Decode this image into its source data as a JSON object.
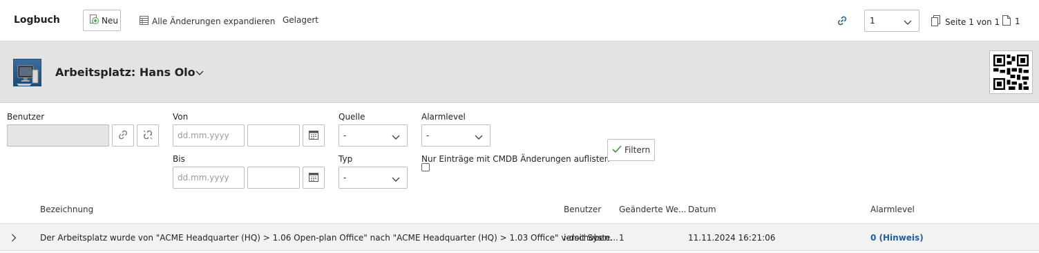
{
  "toolbar": {
    "title": "Logbuch",
    "new_label": "Neu",
    "expand_label": "Alle Änderungen expandieren",
    "archived_label": "Gelagert",
    "page_select_value": "1",
    "page_info": "Seite 1 von 1",
    "page_count": "1"
  },
  "header": {
    "object_title": "Arbeitsplatz: Hans Olo"
  },
  "filter": {
    "benutzer_label": "Benutzer",
    "benutzer_value": "",
    "von_label": "Von",
    "bis_label": "Bis",
    "date_placeholder": "dd.mm.yyyy",
    "quelle_label": "Quelle",
    "quelle_value": "-",
    "typ_label": "Typ",
    "typ_value": "-",
    "alarmlevel_label": "Alarmlevel",
    "alarmlevel_value": "-",
    "cmdb_only_label": "Nur Einträge mit CMDB Änderungen auflisten",
    "filter_button": "Filtern"
  },
  "table": {
    "headers": {
      "bezeichnung": "Bezeichnung",
      "benutzer": "Benutzer",
      "geaenderte": "Geänderte We...",
      "datum": "Datum",
      "alarmlevel": "Alarmlevel"
    },
    "rows": [
      {
        "bezeichnung": "Der Arbeitsplatz wurde von \"ACME Headquarter (HQ) > 1.06 Open-plan Office\" nach \"ACME Headquarter (HQ) > 1.03 Office\" verschoben.",
        "benutzer": "i-doit Syste...",
        "geaenderte": "1",
        "datum": "11.11.2024 16:21:06",
        "alarmlevel": "0 (Hinweis)"
      }
    ]
  },
  "colors": {
    "accent_blue": "#1f5ea8",
    "new_icon_green": "#3a9a3a",
    "header_band": "#e3e3e3"
  }
}
